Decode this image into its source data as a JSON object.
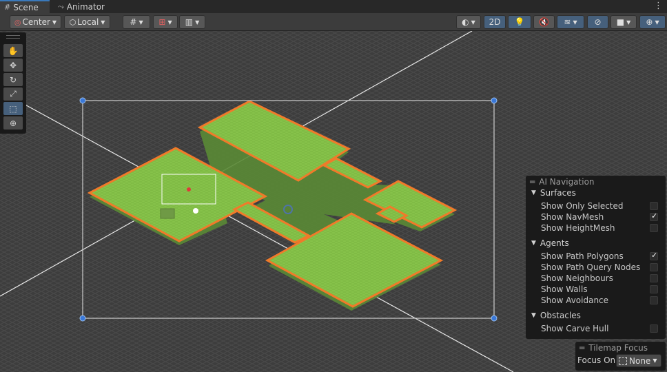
{
  "tabs": [
    {
      "label": "Scene",
      "active": true
    },
    {
      "label": "Animator",
      "active": false
    }
  ],
  "toolbar": {
    "pivot_label": "Center",
    "space_label": "Local",
    "mode_2d_label": "2D"
  },
  "tools": [
    "view-tool",
    "move-tool",
    "rotate-tool",
    "scale-tool",
    "rect-tool",
    "transform-tool"
  ],
  "ai_navigation": {
    "title": "AI Navigation",
    "sections": [
      {
        "name": "Surfaces",
        "options": [
          {
            "label": "Show Only Selected",
            "checked": false
          },
          {
            "label": "Show NavMesh",
            "checked": true
          },
          {
            "label": "Show HeightMesh",
            "checked": false
          }
        ]
      },
      {
        "name": "Agents",
        "options": [
          {
            "label": "Show Path Polygons",
            "checked": true
          },
          {
            "label": "Show Path Query Nodes",
            "checked": false
          },
          {
            "label": "Show Neighbours",
            "checked": false
          },
          {
            "label": "Show Walls",
            "checked": false
          },
          {
            "label": "Show Avoidance",
            "checked": false
          }
        ]
      },
      {
        "name": "Obstacles",
        "options": [
          {
            "label": "Show Carve Hull",
            "checked": false
          }
        ]
      }
    ]
  },
  "tilemap_focus": {
    "title": "Tilemap Focus",
    "focus_label": "Focus On",
    "focus_value": "None"
  },
  "colors": {
    "accent": "#46607c",
    "navmesh_fill": "#86c24a",
    "navmesh_edge": "#f07a2a"
  }
}
